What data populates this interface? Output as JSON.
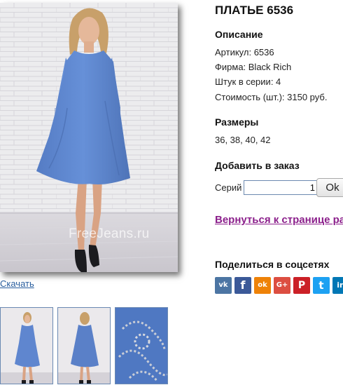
{
  "product": {
    "title": "ПЛАТЬЕ 6536",
    "description_heading": "Описание",
    "article": "Артикул: 6536",
    "brand": "Фирма: Black Rich",
    "per_series": "Штук в серии: 4",
    "price": "Стоимость (шт.): 3150 руб.",
    "sizes_heading": "Размеры",
    "sizes": "36, 38, 40, 42"
  },
  "order": {
    "heading": "Добавить в заказ",
    "series_label": "Серий",
    "quantity": "1",
    "ok_label": "Ok"
  },
  "back_link": "Вернуться к странице раздела",
  "share": {
    "heading": "Поделиться в соцсетях",
    "networks": [
      {
        "name": "vk",
        "glyph": "vk",
        "color": "#4c75a3"
      },
      {
        "name": "facebook",
        "glyph": "f",
        "color": "#3b5998"
      },
      {
        "name": "odnoklassniki",
        "glyph": "ok",
        "color": "#ee8208"
      },
      {
        "name": "google-plus",
        "glyph": "G+",
        "color": "#dc4e41"
      },
      {
        "name": "pinterest",
        "glyph": "P",
        "color": "#cb2027"
      },
      {
        "name": "twitter",
        "glyph": "t",
        "color": "#1da1f2"
      },
      {
        "name": "linkedin",
        "glyph": "in",
        "color": "#0077b5"
      }
    ]
  },
  "gallery": {
    "watermark": "FreeJeans.ru",
    "download_label": "Скачать",
    "thumbnails": [
      "front-view",
      "back-view",
      "sleeve-detail"
    ]
  },
  "colors": {
    "dress": "#5f86cf",
    "link": "#2a5e9e",
    "visited_link": "#8b1f8b"
  }
}
